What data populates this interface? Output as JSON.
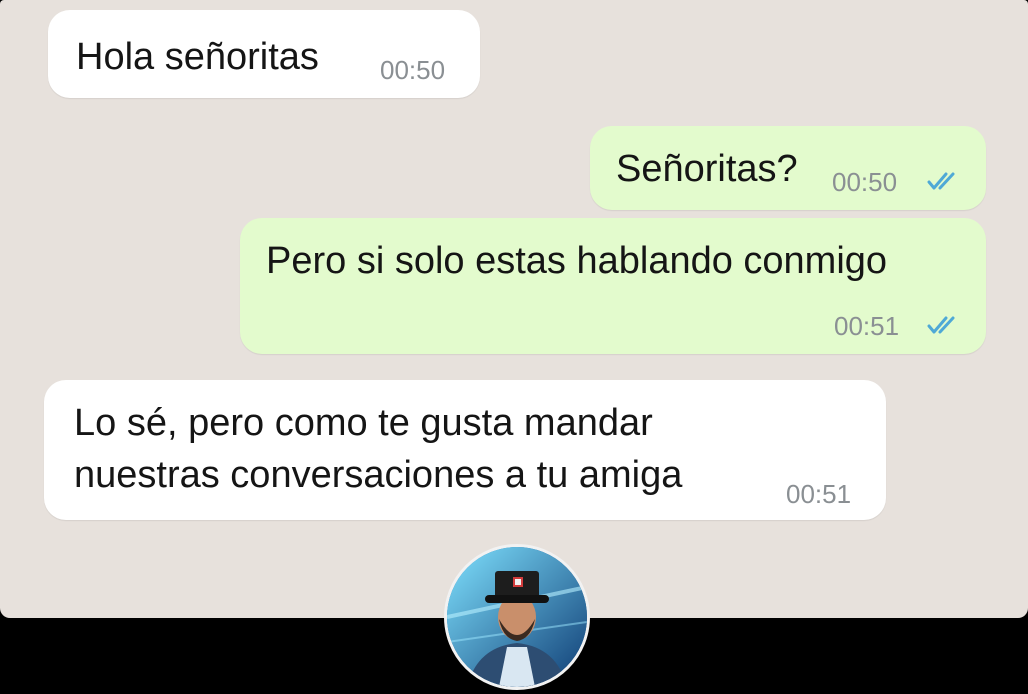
{
  "messages": [
    {
      "id": "m1",
      "direction": "incoming",
      "text": "Hola señoritas",
      "time": "00:50"
    },
    {
      "id": "m2",
      "direction": "outgoing",
      "text": "Señoritas?",
      "time": "00:50",
      "status": "read"
    },
    {
      "id": "m3",
      "direction": "outgoing",
      "text": "Pero si solo estas hablando conmigo",
      "time": "00:51",
      "status": "read"
    },
    {
      "id": "m4",
      "direction": "incoming",
      "lines": [
        "Lo sé, pero como te gusta mandar",
        "nuestras conversaciones a tu amiga"
      ],
      "time": "00:51"
    }
  ],
  "colors": {
    "chat_background": "#e7e1dc",
    "incoming_bubble": "#ffffff",
    "outgoing_bubble": "#e3fbcd",
    "read_ticks": "#4fa9d6",
    "timestamp": "#8a8f93"
  },
  "icons": {
    "read_receipt": "double-check-icon",
    "avatar": "creator-avatar"
  }
}
